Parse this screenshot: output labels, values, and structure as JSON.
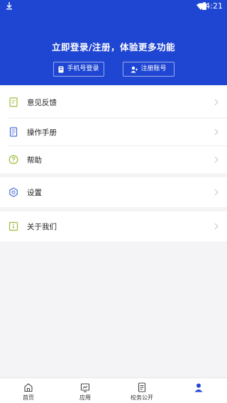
{
  "status_bar": {
    "time": "4:21",
    "icons": [
      "download-icon",
      "wifi-icon",
      "battery-icon"
    ]
  },
  "header": {
    "title": "立即登录/注册，体验更多功能",
    "phone_login_label": "手机号登录",
    "register_label": "注册账号"
  },
  "menu": {
    "items": [
      {
        "label": "意见反馈",
        "icon": "feedback-icon"
      },
      {
        "label": "操作手册",
        "icon": "manual-icon"
      },
      {
        "label": "帮助",
        "icon": "help-icon"
      },
      {
        "label": "设置",
        "icon": "settings-icon"
      },
      {
        "label": "关于我们",
        "icon": "about-icon"
      }
    ]
  },
  "tabbar": {
    "items": [
      {
        "label": "首页",
        "icon": "home-icon"
      },
      {
        "label": "应用",
        "icon": "apps-icon"
      },
      {
        "label": "校务公开",
        "icon": "document-icon"
      },
      {
        "label": "",
        "icon": "user-icon",
        "active": true
      }
    ]
  },
  "colors": {
    "brand_blue": "#1f46d2",
    "icon_green": "#9cbb3b",
    "icon_blue": "#4a6fd6"
  }
}
